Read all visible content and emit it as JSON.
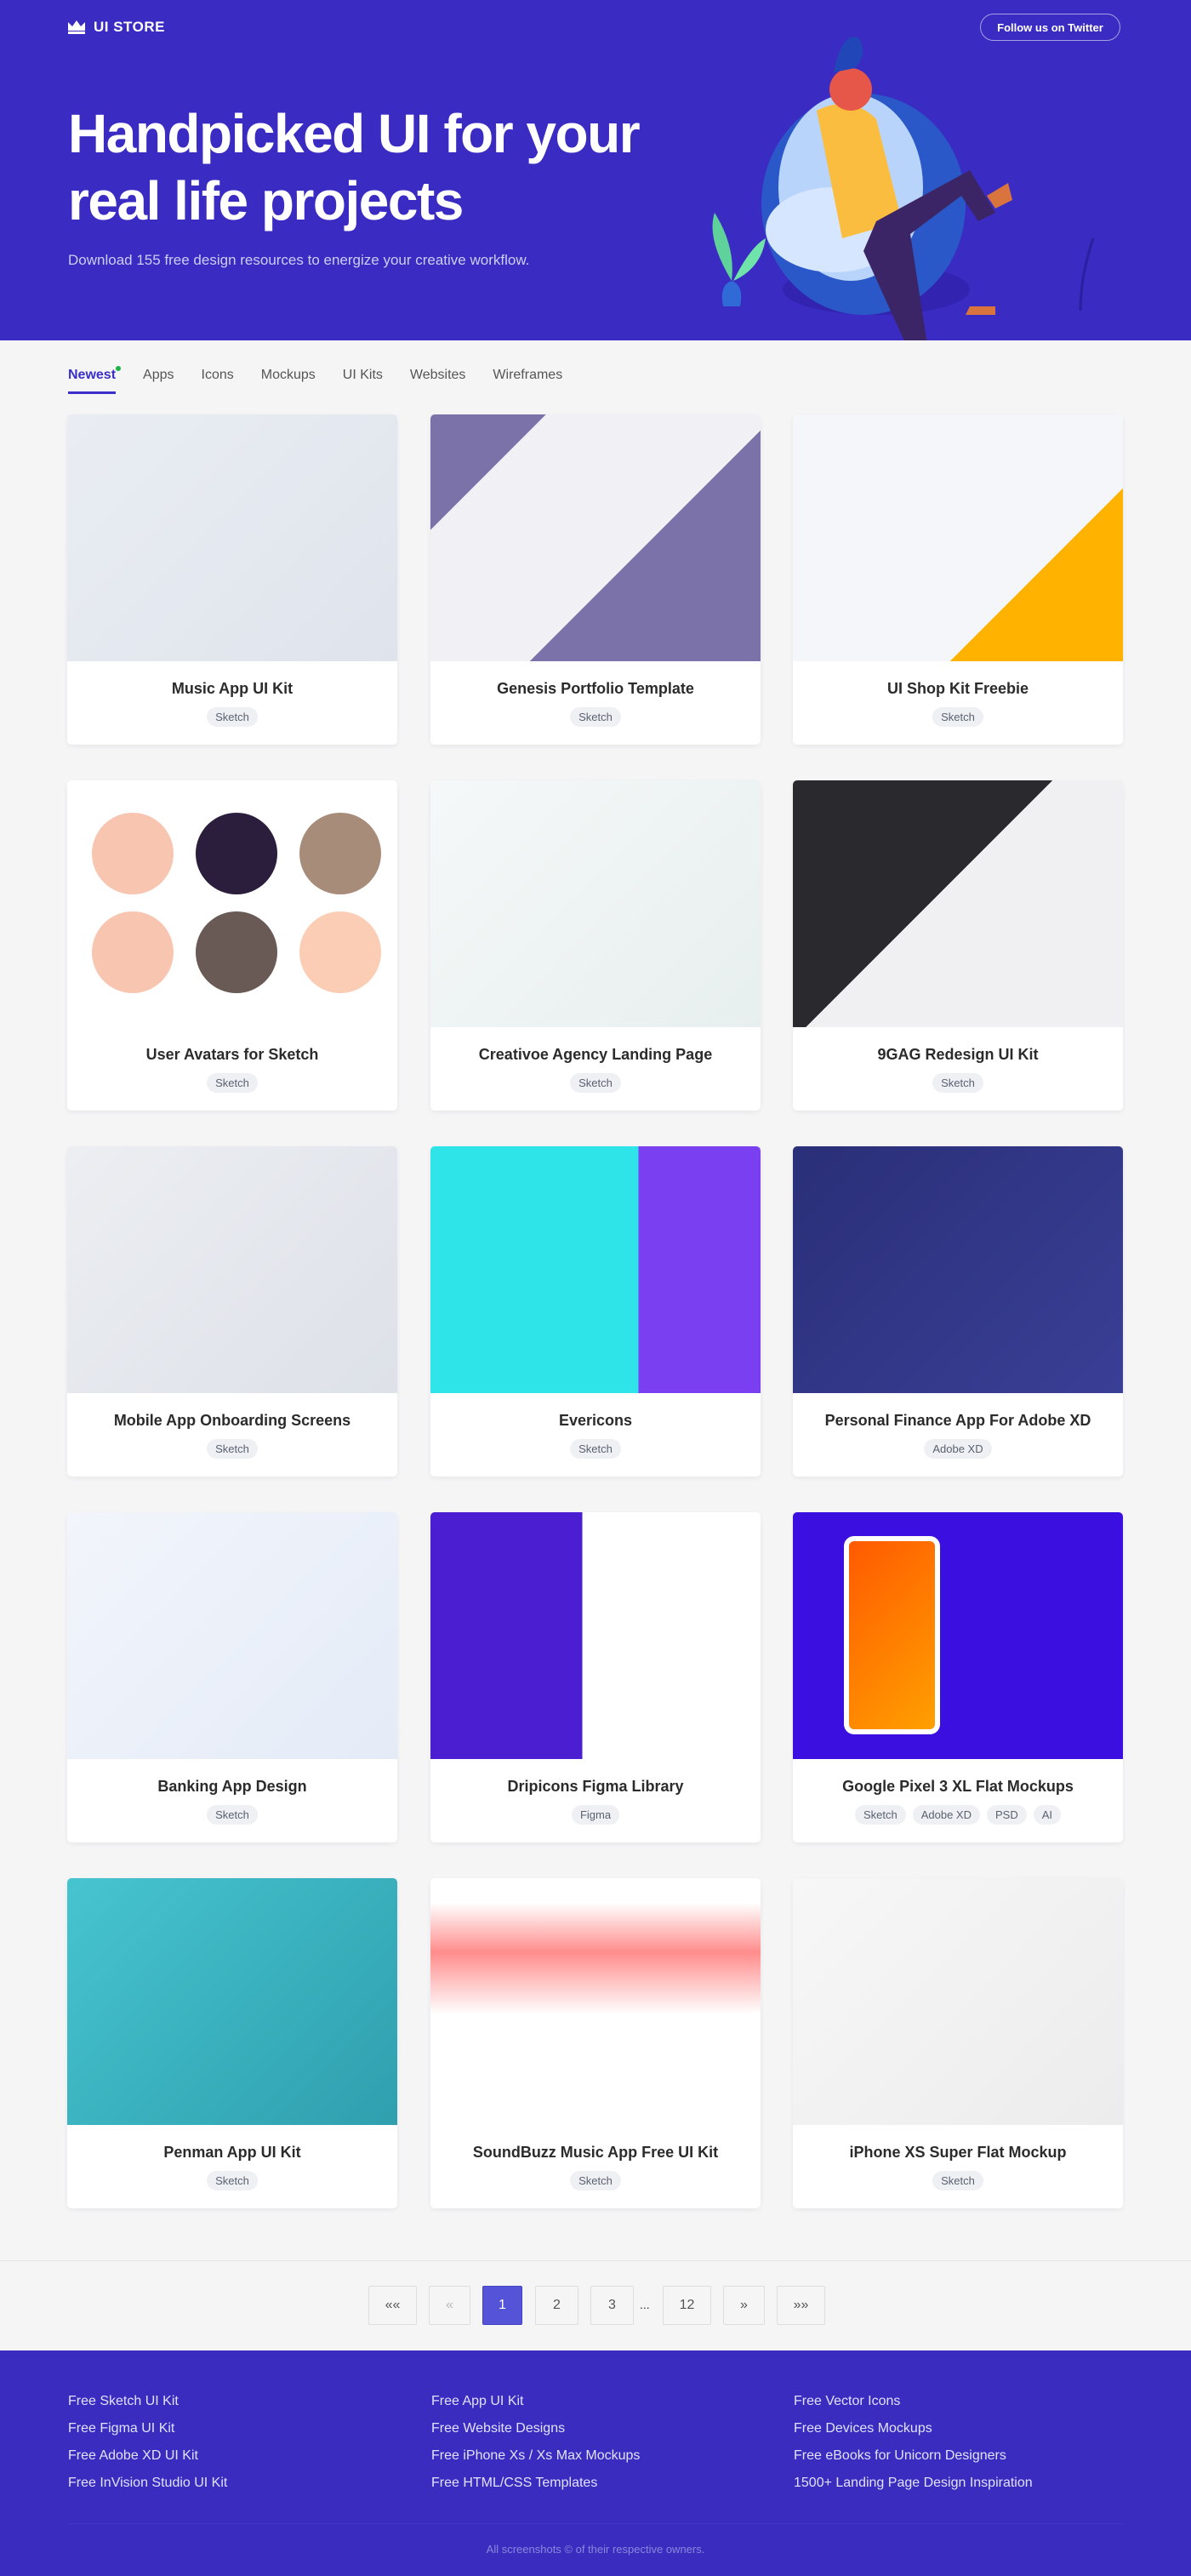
{
  "header": {
    "logo": "UI STORE",
    "twitter_button": "Follow us on Twitter",
    "title": "Handpicked UI for your real life projects",
    "subtitle": "Download 155 free design resources to energize your creative workflow."
  },
  "colors": {
    "brand": "#3a2bc2",
    "accent": "#5553d8",
    "new_dot": "#19b34a"
  },
  "tabs": [
    {
      "label": "Newest",
      "active": true
    },
    {
      "label": "Apps"
    },
    {
      "label": "Icons"
    },
    {
      "label": "Mockups"
    },
    {
      "label": "UI Kits"
    },
    {
      "label": "Websites"
    },
    {
      "label": "Wireframes"
    }
  ],
  "cards": [
    {
      "title": "Music App UI Kit",
      "tags": [
        "Sketch"
      ]
    },
    {
      "title": "Genesis Portfolio Template",
      "tags": [
        "Sketch"
      ]
    },
    {
      "title": "UI Shop Kit Freebie",
      "tags": [
        "Sketch"
      ]
    },
    {
      "title": "User Avatars for Sketch",
      "tags": [
        "Sketch"
      ]
    },
    {
      "title": "Creativoe Agency Landing Page",
      "tags": [
        "Sketch"
      ]
    },
    {
      "title": "9GAG Redesign UI Kit",
      "tags": [
        "Sketch"
      ]
    },
    {
      "title": "Mobile App Onboarding Screens",
      "tags": [
        "Sketch"
      ]
    },
    {
      "title": "Evericons",
      "tags": [
        "Sketch"
      ]
    },
    {
      "title": "Personal Finance App For Adobe XD",
      "tags": [
        "Adobe XD"
      ]
    },
    {
      "title": "Banking App Design",
      "tags": [
        "Sketch"
      ]
    },
    {
      "title": "Dripicons Figma Library",
      "tags": [
        "Figma"
      ]
    },
    {
      "title": "Google Pixel 3 XL Flat Mockups",
      "tags": [
        "Sketch",
        "Adobe XD",
        "PSD",
        "AI"
      ]
    },
    {
      "title": "Penman App UI Kit",
      "tags": [
        "Sketch"
      ]
    },
    {
      "title": "SoundBuzz Music App Free UI Kit",
      "tags": [
        "Sketch"
      ]
    },
    {
      "title": "iPhone XS Super Flat Mockup",
      "tags": [
        "Sketch"
      ]
    }
  ],
  "pagination": {
    "first": "««",
    "prev": "«",
    "pages": [
      "1",
      "2",
      "3"
    ],
    "ellipsis": "...",
    "last_page": "12",
    "next": "»",
    "last": "»»",
    "current": "1"
  },
  "footer": {
    "columns": [
      [
        "Free Sketch UI Kit",
        "Free Figma UI Kit",
        "Free Adobe XD UI Kit",
        "Free InVision Studio UI Kit"
      ],
      [
        "Free App UI Kit",
        "Free Website Designs",
        "Free iPhone Xs / Xs Max Mockups",
        "Free HTML/CSS Templates"
      ],
      [
        "Free Vector Icons",
        "Free Devices Mockups",
        "Free eBooks for Unicorn Designers",
        "1500+ Landing Page Design Inspiration"
      ]
    ],
    "copyright": "All screenshots © of their respective owners."
  }
}
